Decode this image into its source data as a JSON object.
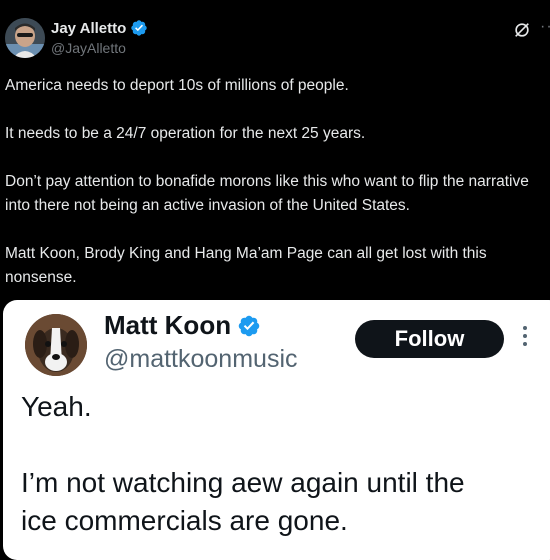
{
  "post": {
    "author_name": "Jay Alletto",
    "author_handle": "@JayAlletto",
    "paragraphs": [
      "America needs to deport 10s of millions of people.",
      "It needs to be a 24/7 operation for the next 25 years.",
      "Don’t pay attention to bonafide morons like  this who want to flip the narrative into there not being an active invasion of the United States.",
      "Matt Koon, Brody King and Hang Ma’am Page can all get lost with this nonsense."
    ]
  },
  "quoted": {
    "author_name": "Matt Koon",
    "author_handle": "@mattkoonmusic",
    "follow_label": "Follow",
    "line1": "Yeah.",
    "line2": "I’m not watching aew again until the",
    "line3": "ice commercials are gone."
  },
  "colors": {
    "verified_blue": "#1d9bf0",
    "background": "#000000",
    "card_background": "#ffffff"
  },
  "icons": [
    "verified-badge-icon",
    "grok-icon",
    "more-icon"
  ]
}
